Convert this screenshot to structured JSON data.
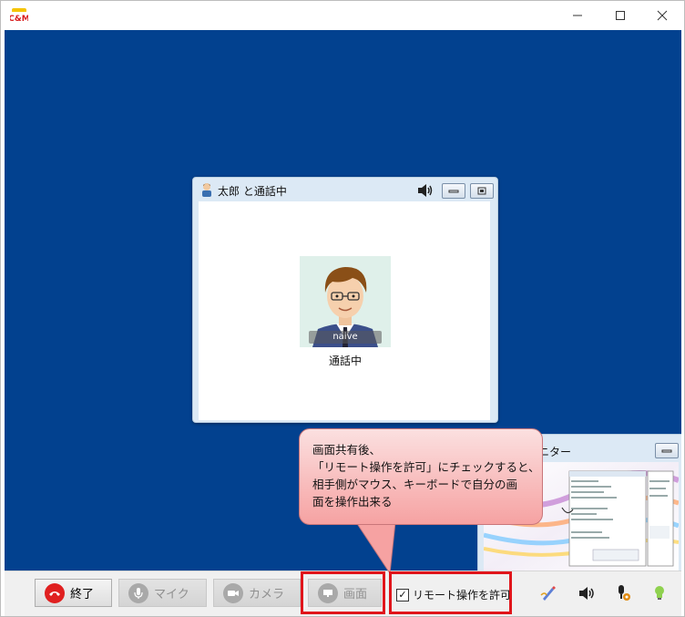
{
  "app": {
    "logo_text": "C&M",
    "window_controls": [
      "minimize-icon",
      "maximize-icon",
      "close-icon"
    ]
  },
  "call_window": {
    "title": "太郎 と通話中",
    "avatar_label": "naive",
    "status": "通話中",
    "icons": [
      "user-icon",
      "speaker-icon",
      "minimize-button",
      "restore-button"
    ]
  },
  "monitor_window": {
    "title": "ニター"
  },
  "callout": {
    "lines": [
      "画面共有後、",
      "「リモート操作を許可」にチェックすると、",
      "相手側がマウス、キーボードで自分の画",
      "面を操作出来る"
    ]
  },
  "toolbar": {
    "end_label": "終了",
    "mic_label": "マイク",
    "camera_label": "カメラ",
    "screen_label": "画面",
    "remote_label": "リモート操作を許可",
    "remote_checked": true,
    "tray_icons": [
      "pen-icon",
      "speaker-icon",
      "device-settings-icon",
      "lightbulb-icon"
    ]
  },
  "colors": {
    "stage_background": "#02418f",
    "highlight": "#e0151b",
    "end_call": "#e02020",
    "callout": "#f6a2a2"
  }
}
